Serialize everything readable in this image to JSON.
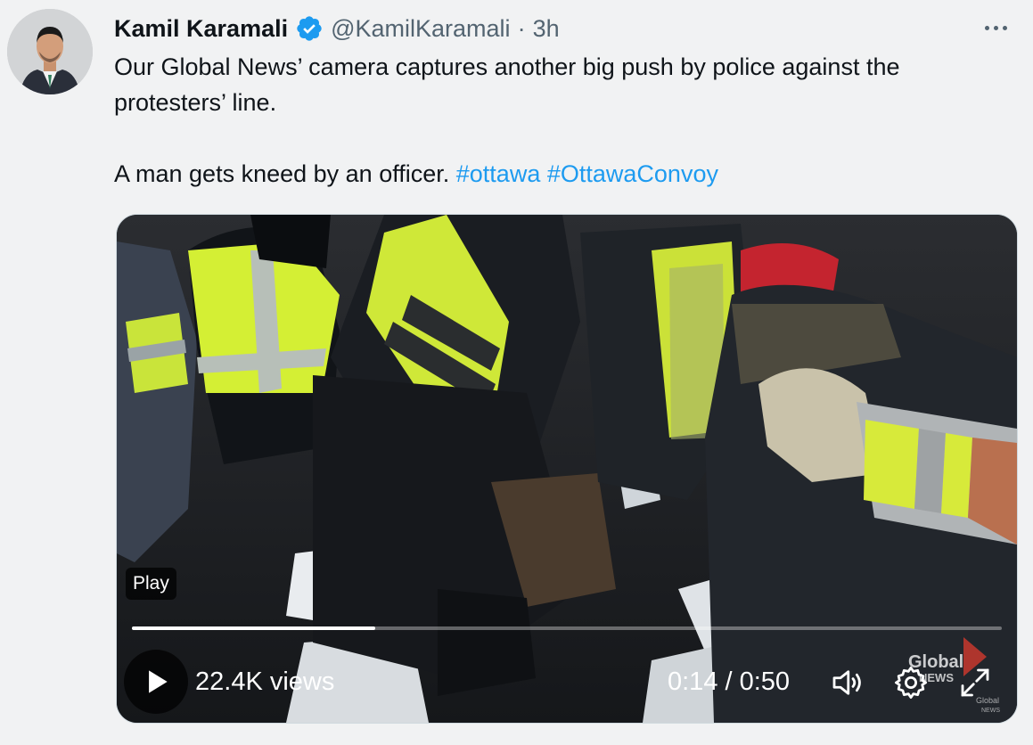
{
  "tweet": {
    "author": {
      "display_name": "Kamil Karamali",
      "handle": "@KamilKaramali",
      "separator": "·",
      "time": "3h",
      "verified_color": "#1d9bf0"
    },
    "text": {
      "line1": "Our Global News’ camera captures another big push by police against the protesters’ line.",
      "line2_plain": "A man gets kneed by an officer.",
      "hashtags": [
        "#ottawa",
        "#OttawaConvoy"
      ]
    }
  },
  "video": {
    "play_label": "Play",
    "views": "22.4K views",
    "timecode": "0:14 / 0:50",
    "progress_fraction": 0.28,
    "watermark_text": "Global NEWS",
    "controls": {
      "play_icon": "play-icon",
      "volume_icon": "volume-icon",
      "settings_icon": "gear-icon",
      "fullscreen_icon": "fullscreen-icon"
    }
  }
}
